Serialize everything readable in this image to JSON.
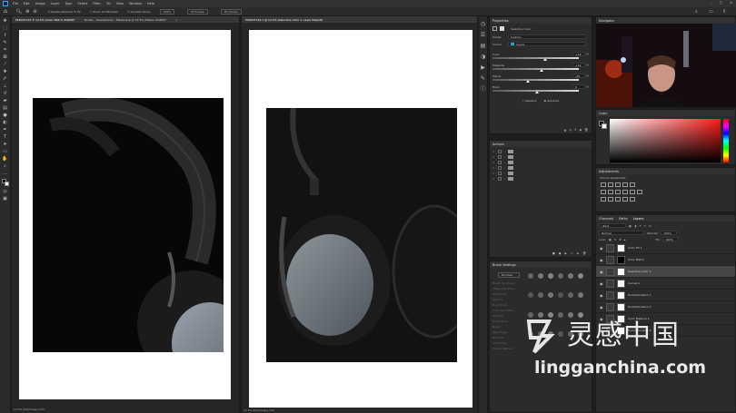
{
  "menubar": {
    "app_icon": "ps-icon",
    "items": [
      "File",
      "Edit",
      "Image",
      "Layer",
      "Type",
      "Select",
      "Filter",
      "3D",
      "View",
      "Window",
      "Help"
    ],
    "controls": [
      "–",
      "□",
      "✕"
    ]
  },
  "options_bar": {
    "items": [
      "Resize Windows to Fit",
      "Zoom All Windows",
      "Scrubby Zoom",
      "100%",
      "Fit Screen",
      "Fill Screen"
    ]
  },
  "documents": {
    "left_tabs": [
      "PSK007129 © 12.5% (Color Match, RGB/8)*",
      "Pocket – Headphones – Masks.psb @ 12.5% (Masks, RGB/8)*",
      "»"
    ],
    "right_tabs": [
      "PSK007129-1 @ 12.5% (Selective Color 1, Layer Mask/8)"
    ],
    "left_status": "12.5%   Preliminary Info",
    "right_status": "12.5%   Preliminary Info"
  },
  "properties": {
    "title": "Properties",
    "subtitle": "Selective Color",
    "preset_label": "Preset:",
    "preset_value": "Custom",
    "colors_label": "Colors:",
    "colors_value": "Cyans",
    "sliders": [
      {
        "label": "Cyan",
        "value": "+19",
        "unit": "%",
        "level": 0.6
      },
      {
        "label": "Magenta",
        "value": "+12",
        "unit": "%",
        "level": 0.56
      },
      {
        "label": "Yellow",
        "value": "-20",
        "unit": "%",
        "level": 0.4
      },
      {
        "label": "Black",
        "value": "0",
        "unit": "%",
        "level": 0.5
      }
    ],
    "method_relative": "Relative",
    "method_absolute": "Absolute"
  },
  "actions": {
    "title": "Actions",
    "rows": [
      "",
      "",
      "",
      "",
      "",
      ""
    ]
  },
  "brush_settings": {
    "title": "Brush Settings",
    "brushes_button": "Brushes",
    "options": [
      "Brush Tip Shape",
      "Shape Dynamics",
      "Scattering",
      "Texture",
      "Dual Brush",
      "Color Dynamics",
      "Transfer",
      "Brush Pose",
      "Noise",
      "Wet Edges",
      "Build-up",
      "Smoothing",
      "Protect Texture"
    ]
  },
  "navigator": {
    "title": "Navigator"
  },
  "color": {
    "title": "Color"
  },
  "adjustments": {
    "title": "Adjustments",
    "hint": "Add an adjustment"
  },
  "layers": {
    "tabs": [
      "Channels",
      "Paths",
      "Layers"
    ],
    "kind_label": "Kind",
    "blend_mode": "Normal",
    "opacity_label": "Opacity:",
    "opacity_value": "100%",
    "lock_label": "Lock:",
    "fill_label": "Fill:",
    "fill_value": "100%",
    "rows": [
      {
        "name": "Color Fill 1"
      },
      {
        "name": "Color Match"
      },
      {
        "name": "Selective Color 1"
      },
      {
        "name": "Curves 1"
      },
      {
        "name": "Hue/Saturation 1"
      },
      {
        "name": "Hue/Saturation 2"
      },
      {
        "name": "Color Balance 1"
      },
      {
        "name": "Hue/Saturation 3"
      }
    ]
  },
  "watermark": {
    "cn": "灵感中国",
    "url": "lingganchina.com"
  },
  "colors": {
    "menu_bg": "#323232",
    "panel_bg": "#2b2b2b",
    "canvas_bg": "#262626",
    "accent": "#1473e6"
  }
}
